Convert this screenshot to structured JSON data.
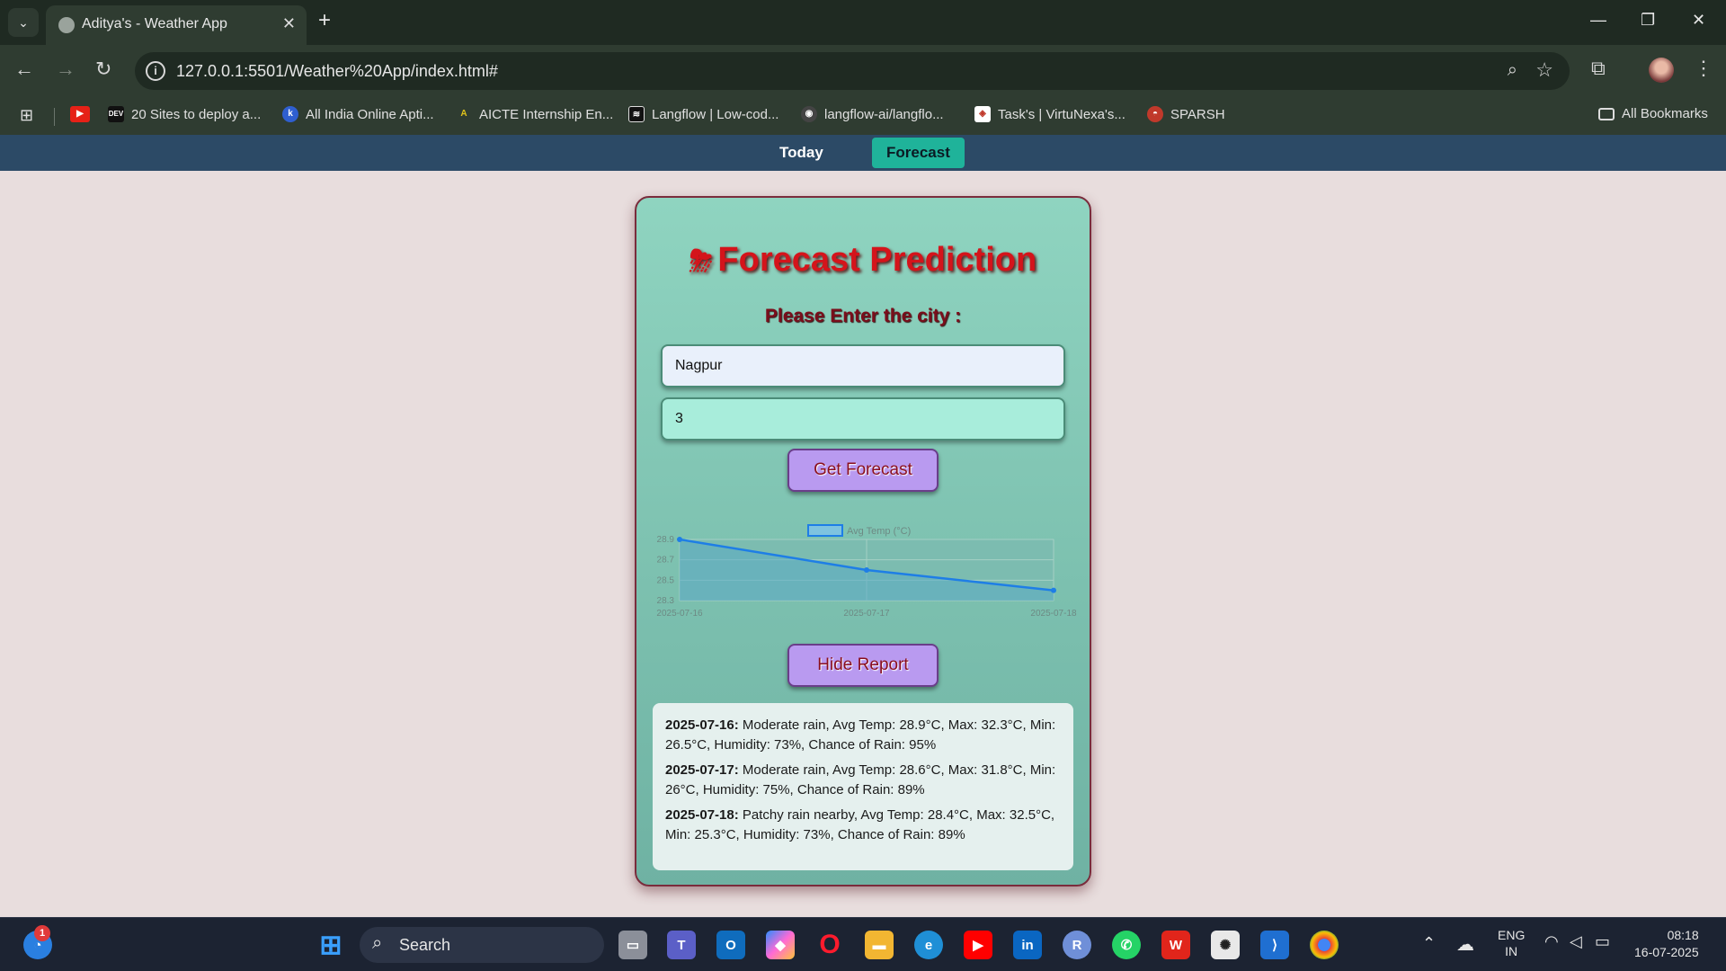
{
  "browser": {
    "tab_title": "Aditya's - Weather App",
    "url": "127.0.0.1:5501/Weather%20App/index.html#",
    "bookmarks": [
      {
        "label": "20 Sites to deploy a...",
        "icon": "dev-icon",
        "color": "#111111"
      },
      {
        "label": "All India Online Apti...",
        "icon": "k-icon",
        "color": "#2f5fd0"
      },
      {
        "label": "AICTE Internship En...",
        "icon": "aicte-icon",
        "color": "#d4b21b"
      },
      {
        "label": "Langflow | Low-cod...",
        "icon": "langflow-icon",
        "color": "#111111"
      },
      {
        "label": "langflow-ai/langflo...",
        "icon": "github-icon",
        "color": "#444444"
      },
      {
        "label": "Task's | VirtuNexa's...",
        "icon": "virtunexa-icon",
        "color": "#ffffff"
      },
      {
        "label": "SPARSH",
        "icon": "sparsh-icon",
        "color": "#c0392b"
      }
    ],
    "all_bookmarks_label": "All Bookmarks"
  },
  "app": {
    "nav": {
      "today_label": "Today",
      "forecast_label": "Forecast"
    },
    "title": "Forecast Prediction",
    "title_icon": "⛈",
    "prompt": "Please Enter the city :",
    "city_value": "Nagpur",
    "days_value": "3",
    "get_forecast_label": "Get Forecast",
    "hide_report_label": "Hide Report",
    "report": [
      {
        "date": "2025-07-16:",
        "text": " Moderate rain, Avg Temp: 28.9°C, Max: 32.3°C, Min: 26.5°C, Humidity: 73%, Chance of Rain: 95%"
      },
      {
        "date": "2025-07-17:",
        "text": " Moderate rain, Avg Temp: 28.6°C, Max: 31.8°C, Min: 26°C, Humidity: 75%, Chance of Rain: 89%"
      },
      {
        "date": "2025-07-18:",
        "text": " Patchy rain nearby, Avg Temp: 28.4°C, Max: 32.5°C, Min: 25.3°C, Humidity: 73%, Chance of Rain: 89%"
      }
    ]
  },
  "chart_data": {
    "type": "line",
    "x": [
      "2025-07-16",
      "2025-07-17",
      "2025-07-18"
    ],
    "series": [
      {
        "name": "Avg Temp (°C)",
        "values": [
          28.9,
          28.6,
          28.4
        ]
      }
    ],
    "y_ticks": [
      "28.9",
      "28.7",
      "28.5",
      "28.3"
    ],
    "ylim": [
      28.3,
      28.9
    ],
    "line_color": "#1e7ee6",
    "fill_color": "#5aa9c4",
    "grid": true,
    "legend_position": "top"
  },
  "taskbar": {
    "search_label": "Search",
    "lang": "ENG",
    "region": "IN",
    "time": "08:18",
    "date": "16-07-2025",
    "notification_count": "1"
  }
}
